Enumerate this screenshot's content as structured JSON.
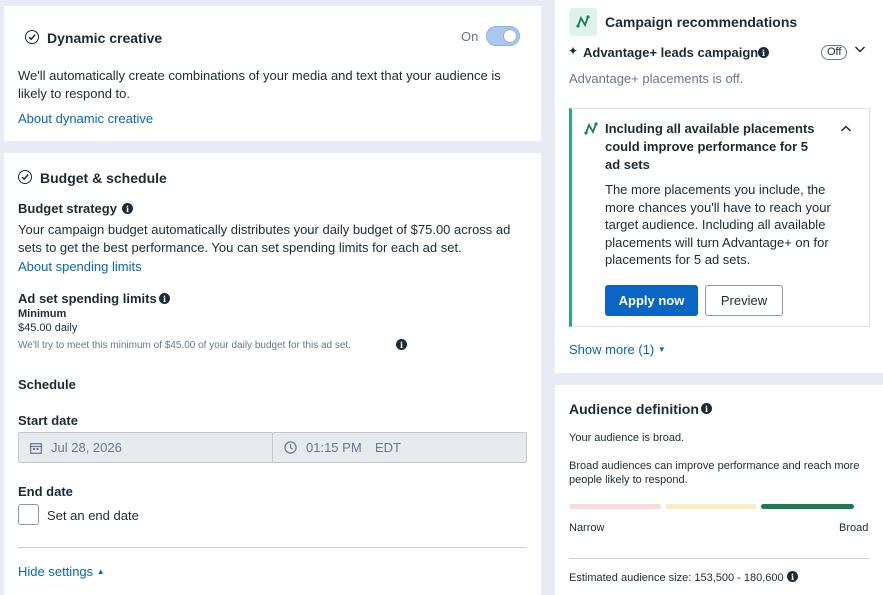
{
  "dynamic_creative": {
    "title": "Dynamic creative",
    "toggle_label": "On",
    "description": "We'll automatically create combinations of your media and text that your audience is likely to respond to.",
    "about_link": "About dynamic creative"
  },
  "budget_schedule": {
    "title": "Budget & schedule",
    "strategy_label": "Budget strategy",
    "strategy_text": "Your campaign budget automatically distributes your daily budget of $75.00 across ad sets to get the best performance. You can set spending limits for each ad set.",
    "spending_limits_link": "About spending limits",
    "ad_set_limits_label": "Ad set spending limits",
    "minimum_label": "Minimum",
    "minimum_value": "$45.00 daily",
    "minimum_note": "We'll try to meet this minimum of $45.00 of your daily budget for this ad set.",
    "schedule_label": "Schedule",
    "start_date_label": "Start date",
    "start_date_value": "Jul 28, 2026",
    "start_time_value": "01:15 PM",
    "timezone": "EDT",
    "end_date_label": "End date",
    "end_date_checkbox_label": "Set an end date",
    "hide_settings_link": "Hide settings"
  },
  "recommendations": {
    "title": "Campaign recommendations",
    "advantage_label": "Advantage+ leads campaign",
    "advantage_status": "Off",
    "placements_status": "Advantage+ placements is off.",
    "rec_title": "Including all available placements could improve performance for 5 ad sets",
    "rec_body": "The more placements you include, the more chances you'll have to reach your target audience. Including all available placements will turn Advantage+ on for placements for 5 ad sets.",
    "apply_button": "Apply now",
    "preview_button": "Preview",
    "show_more": "Show more (1)"
  },
  "audience": {
    "title": "Audience definition",
    "status": "Your audience is broad.",
    "description": "Broad audiences can improve performance and reach more people likely to respond.",
    "narrow_label": "Narrow",
    "broad_label": "Broad",
    "estimated_size": "Estimated audience size: 153,500 - 180,600",
    "level": "broad",
    "colors": {
      "narrow": "#f6dcdc",
      "middle": "#f7eec4",
      "broad": "#1f7a4d"
    }
  }
}
